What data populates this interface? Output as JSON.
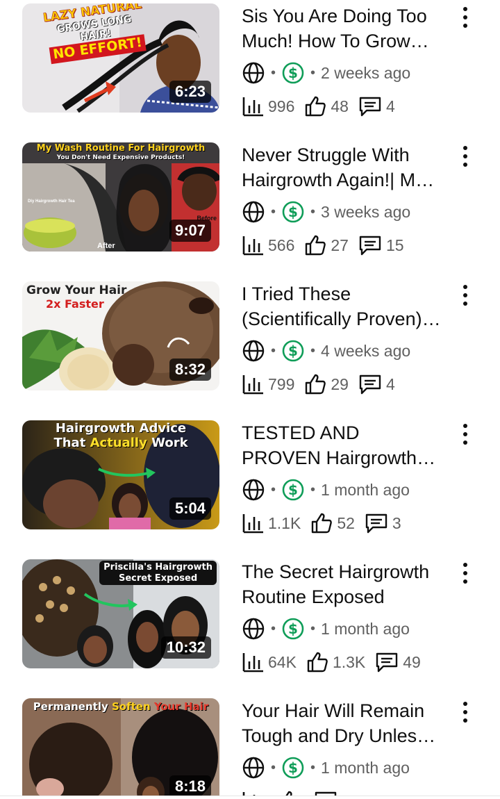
{
  "videos": [
    {
      "title": "Sis You Are Doing Too Much! How To Grow Long Hair",
      "thumb_text": [
        "LAZY NATURAL",
        "GROWS LONG HAIR!",
        "NO EFFORT!"
      ],
      "duration": "6:23",
      "age": "2 weeks ago",
      "views": "996",
      "likes": "48",
      "comments": "4"
    },
    {
      "title": "Never Struggle With Hairgrowth Again!| My Wash Routine",
      "thumb_text": [
        "My Wash Routine For Hairgrowth",
        "You Don't Need Expensive Products!",
        "Diy Hairgrowth Hair Tea",
        "Before",
        "After"
      ],
      "duration": "9:07",
      "age": "3 weeks ago",
      "views": "566",
      "likes": "27",
      "comments": "15"
    },
    {
      "title": "I Tried These (Scientifically Proven) Hair Growth Tips",
      "thumb_text": [
        "Grow Your Hair",
        "2x Faster"
      ],
      "duration": "8:32",
      "age": "4 weeks ago",
      "views": "799",
      "likes": "29",
      "comments": "4"
    },
    {
      "title": "TESTED AND PROVEN Hairgrowth Advice That Actually Works",
      "thumb_text": [
        "Hairgrowth Advice",
        "That",
        "Actually",
        "Work"
      ],
      "duration": "5:04",
      "age": "1 month ago",
      "views": "1.1K",
      "likes": "52",
      "comments": "3"
    },
    {
      "title": "The Secret Hairgrowth Routine Exposed",
      "thumb_text": [
        "Priscilla's Hairgrowth",
        "Secret Exposed"
      ],
      "duration": "10:32",
      "age": "1 month ago",
      "views": "64K",
      "likes": "1.3K",
      "comments": "49"
    },
    {
      "title": "Your Hair Will Remain Tough and Dry Unless You Do This",
      "thumb_text": [
        "Permanently",
        "Soften",
        "Your",
        "Hair"
      ],
      "duration": "8:18",
      "age": "1 month ago",
      "views": "",
      "likes": "",
      "comments": ""
    }
  ],
  "icons": {
    "visibility": "globe-icon",
    "monetization": "dollar-circle-icon",
    "views": "bar-chart-icon",
    "likes": "thumbs-up-icon",
    "comments": "comment-icon",
    "more": "more-vertical-icon"
  },
  "colors": {
    "monetized": "#0f9d58",
    "duration_bg": "#000000",
    "meta_text": "#606060"
  }
}
